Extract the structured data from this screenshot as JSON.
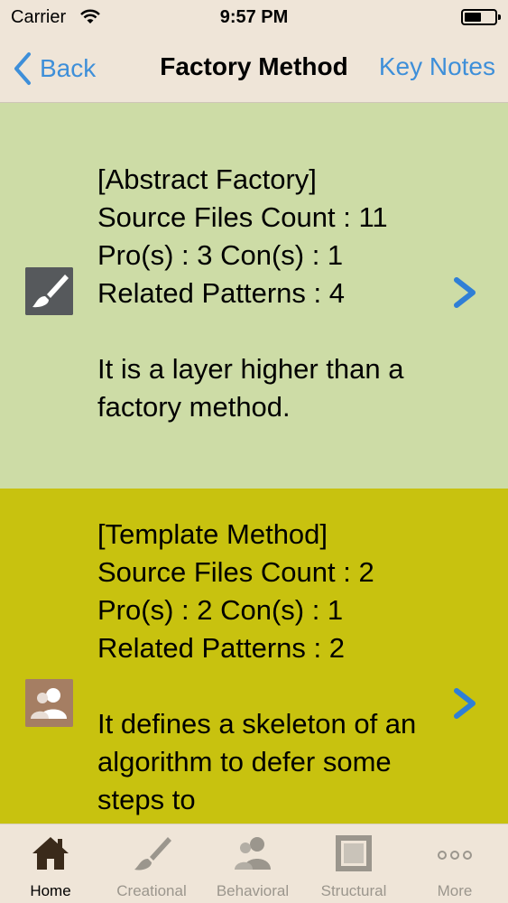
{
  "status_bar": {
    "carrier": "Carrier",
    "time": "9:57 PM",
    "battery_level": 0.55
  },
  "nav": {
    "back_label": "Back",
    "title": "Factory Method",
    "right_button": "Key Notes"
  },
  "rows": [
    {
      "name": "[Abstract Factory]",
      "source_files": "Source Files Count : 11",
      "pros_cons": "Pro(s) : 3 Con(s) : 1",
      "related": "Related Patterns : 4",
      "description": "It is a layer higher than a factory method.",
      "icon": "paintbrush-icon",
      "background": "#cddca6"
    },
    {
      "name": "[Template Method]",
      "source_files": "Source Files Count : 2",
      "pros_cons": "Pro(s) : 2 Con(s) : 1",
      "related": "Related Patterns : 2",
      "description": "It defines a skeleton of an algorithm to defer some steps to",
      "icon": "users-icon",
      "background": "#c8c20f"
    }
  ],
  "tabs": [
    {
      "label": "Home",
      "icon": "home-icon",
      "active": true
    },
    {
      "label": "Creational",
      "icon": "paintbrush-icon",
      "active": false
    },
    {
      "label": "Behavioral",
      "icon": "users-icon",
      "active": false
    },
    {
      "label": "Structural",
      "icon": "frame-icon",
      "active": false
    },
    {
      "label": "More",
      "icon": "more-dots-icon",
      "active": false
    }
  ],
  "colors": {
    "accent": "#3e8fd9",
    "bar_bg": "#efe5d8",
    "inactive_tab": "#9b968d"
  }
}
